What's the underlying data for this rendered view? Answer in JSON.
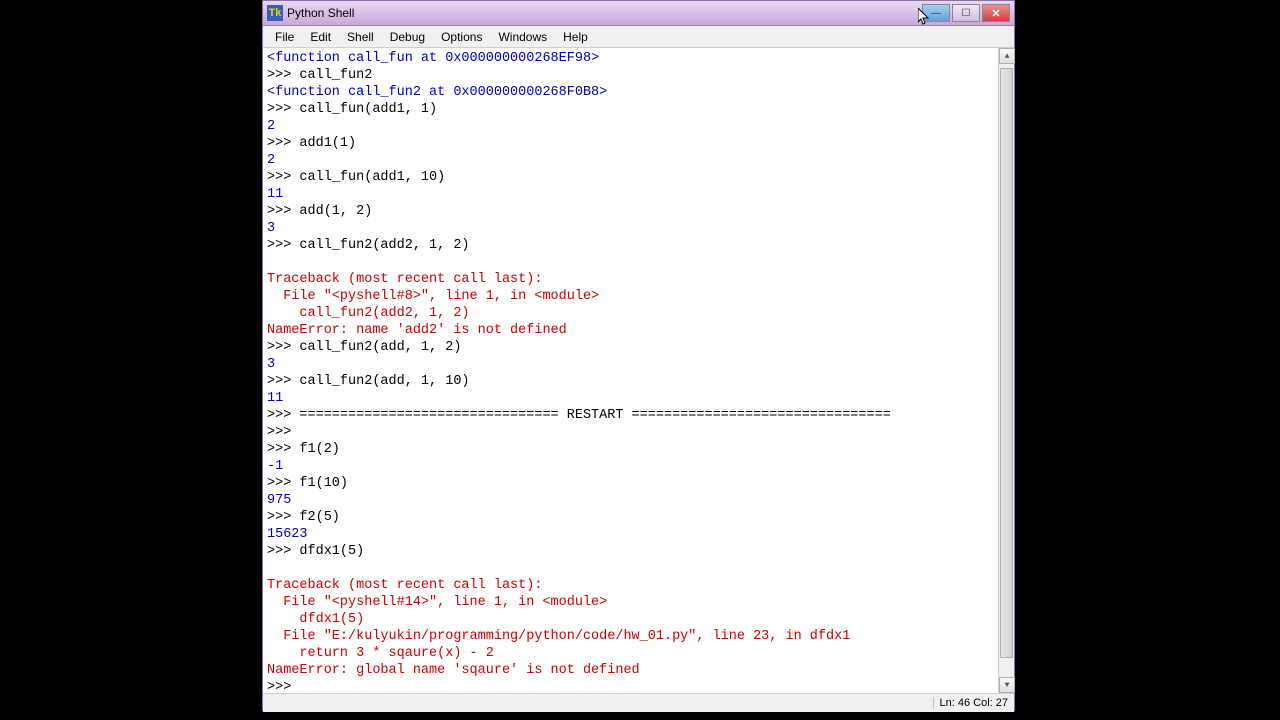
{
  "window": {
    "title": "Python Shell"
  },
  "menu": {
    "file": "File",
    "edit": "Edit",
    "shell": "Shell",
    "debug": "Debug",
    "options": "Options",
    "windows": "Windows",
    "help": "Help"
  },
  "lines": {
    "l0": "<function call_fun at 0x000000000268EF98>",
    "l1p": ">>> ",
    "l1c": "call_fun2",
    "l2": "<function call_fun2 at 0x000000000268F0B8>",
    "l3p": ">>> ",
    "l3c": "call_fun(add1, 1)",
    "l4": "2",
    "l5p": ">>> ",
    "l5c": "add1(1)",
    "l6": "2",
    "l7p": ">>> ",
    "l7c": "call_fun(add1, 10)",
    "l8": "11",
    "l9p": ">>> ",
    "l9c": "add(1, 2)",
    "l10": "3",
    "l11p": ">>> ",
    "l11c": "call_fun2(add2, 1, 2)",
    "l12": "",
    "l13": "Traceback (most recent call last):",
    "l14": "  File \"<pyshell#8>\", line 1, in <module>",
    "l15": "    call_fun2(add2, 1, 2)",
    "l16": "NameError: name 'add2' is not defined",
    "l17p": ">>> ",
    "l17c": "call_fun2(add, 1, 2)",
    "l18": "3",
    "l19p": ">>> ",
    "l19c": "call_fun2(add, 1, 10)",
    "l20": "11",
    "l21p": ">>> ",
    "l21c": "================================ RESTART ================================",
    "l22p": ">>> ",
    "l22c": "",
    "l23p": ">>> ",
    "l23c": "f1(2)",
    "l24": "-1",
    "l25p": ">>> ",
    "l25c": "f1(10)",
    "l26": "975",
    "l27p": ">>> ",
    "l27c": "f2(5)",
    "l28": "15623",
    "l29p": ">>> ",
    "l29c": "dfdx1(5)",
    "l30": "",
    "l31": "Traceback (most recent call last):",
    "l32": "  File \"<pyshell#14>\", line 1, in <module>",
    "l33": "    dfdx1(5)",
    "l34": "  File \"E:/kulyukin/programming/python/code/hw_01.py\", line 23, in dfdx1",
    "l35": "    return 3 * sqaure(x) - 2",
    "l36": "NameError: global name 'sqaure' is not defined",
    "l37p": ">>> ",
    "l37c": ""
  },
  "status": {
    "text": "Ln: 46 Col: 27"
  }
}
